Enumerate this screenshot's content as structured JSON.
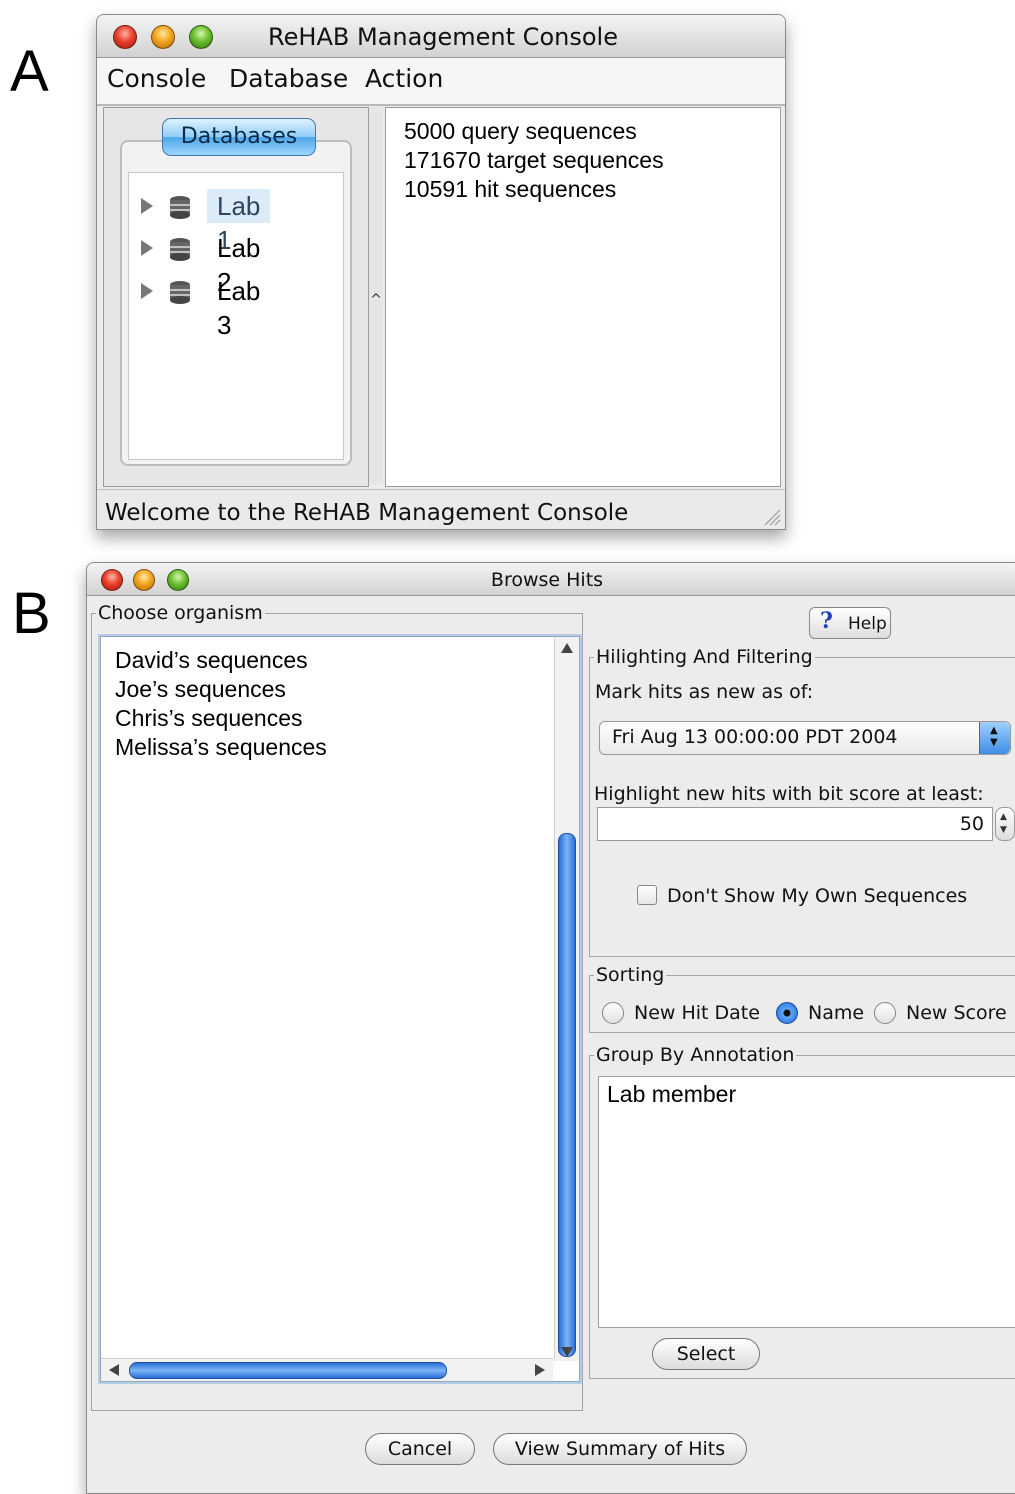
{
  "panel_labels": {
    "a": "A",
    "b": "B"
  },
  "window_a": {
    "title": "ReHAB Management Console",
    "menu": [
      "Console",
      "Database",
      "Action"
    ],
    "databases_button": "Databases",
    "tree": [
      {
        "label": "Lab 1",
        "selected": true,
        "icon": "database-icon"
      },
      {
        "label": "Lab 2",
        "selected": false,
        "icon": "database-icon"
      },
      {
        "label": "Lab 3",
        "selected": false,
        "icon": "database-icon"
      }
    ],
    "splitter_caret": "^",
    "stats": [
      "5000 query sequences",
      "171670 target sequences",
      "10591 hit sequences"
    ],
    "status": "Welcome to the ReHAB Management Console"
  },
  "window_b": {
    "title": "Browse Hits",
    "choose_organism": {
      "legend": "Choose organism",
      "items": [
        "David’s sequences",
        "Joe’s sequences",
        "Chris’s sequences",
        "Melissa’s sequences"
      ]
    },
    "help_button": {
      "icon": "question-icon",
      "glyph": "?",
      "label": "Help"
    },
    "hilighting": {
      "legend": "Hilighting And Filtering",
      "mark_label": "Mark hits as new as of:",
      "date_value": "Fri Aug 13 00:00:00 PDT 2004",
      "score_label": "Highlight new hits with bit score at least:",
      "score_value": "50",
      "dont_show_label": "Don't Show My Own Sequences",
      "dont_show_checked": false
    },
    "sorting": {
      "legend": "Sorting",
      "options": [
        {
          "label": "New Hit Date",
          "selected": false
        },
        {
          "label": "Name",
          "selected": true
        },
        {
          "label": "New Score",
          "selected": false
        }
      ]
    },
    "group_by": {
      "legend": "Group By Annotation",
      "items": [
        "Lab member"
      ],
      "select_button": "Select"
    },
    "cancel_button": "Cancel",
    "view_summary_button": "View Summary of Hits"
  },
  "colors": {
    "accent_blue": "#3d8ee6",
    "selection": "#dcebf8",
    "window_bg": "#ececec"
  }
}
